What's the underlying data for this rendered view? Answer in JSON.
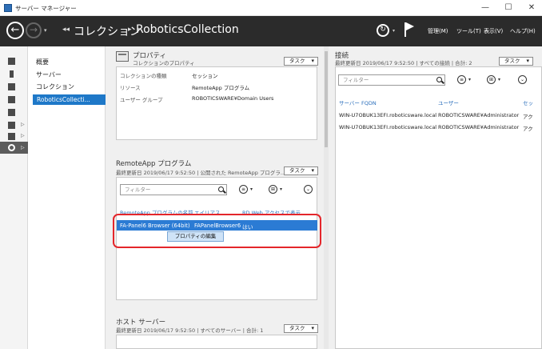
{
  "window": {
    "title": "サーバー マネージャー",
    "controls": [
      "—",
      "☐",
      "✕"
    ]
  },
  "navbar": {
    "back_glyph": "←",
    "forward_glyph": "→",
    "breadcrumb": [
      "コレクション",
      "RoboticsCollection"
    ],
    "breadcrumb_sep": "▸",
    "menus": [
      "管理(M)",
      "ツール(T)",
      "表示(V)",
      "ヘルプ(H)"
    ]
  },
  "subnav": {
    "items": [
      "概要",
      "サーバー",
      "コレクション"
    ],
    "active": "RoboticsCollecti..."
  },
  "properties": {
    "title": "プロパティ",
    "subtitle": "コレクションのプロパティ",
    "task_label": "タスク",
    "rows": [
      {
        "label": "コレクションの種類",
        "value": "セッション"
      },
      {
        "label": "リソース",
        "value": "RemoteApp プログラム"
      },
      {
        "label": "ユーザー グループ",
        "value": "ROBOTICSWARE¥Domain Users"
      }
    ]
  },
  "connections": {
    "title": "接続",
    "subtitle": "最終更新日 2019/06/17 9:52:50 | すべての接続 | 合計: 2",
    "task_label": "タスク",
    "filter_placeholder": "フィルター",
    "columns": [
      "サーバー FQDN",
      "ユーザー",
      "セッ"
    ],
    "rows": [
      [
        "WIN-U7OBUK13EFI.roboticsware.local",
        "ROBOTICSWARE¥Administrator",
        "アク"
      ],
      [
        "WIN-U7OBUK13EFI.roboticsware.local",
        "ROBOTICSWARE¥Administrator",
        "アク"
      ]
    ]
  },
  "remoteapp": {
    "title": "RemoteApp プログラム",
    "subtitle": "最終更新日 2019/06/17 9:52:50 | 公開された RemoteApp プログラ...",
    "task_label": "タスク",
    "filter_placeholder": "フィルター",
    "columns": [
      "RemoteApp プログラムの名前",
      "エイリアス",
      "RD Web アクセスで表示"
    ],
    "selected_row": [
      "FA-Panel6 Browser (64bit)",
      "FAPanelBrowser6",
      "はい"
    ],
    "context_menu": "プロパティの編集"
  },
  "hostservers": {
    "title": "ホスト サーバー",
    "subtitle": "最終更新日 2019/06/17 9:52:50 | すべてのサーバー | 合計: 1",
    "task_label": "タスク"
  },
  "colors": {
    "navbar": "#2b2b2b",
    "selection": "#2b7bd4",
    "active_nav": "#1e78c8",
    "highlight": "#e4262b"
  }
}
